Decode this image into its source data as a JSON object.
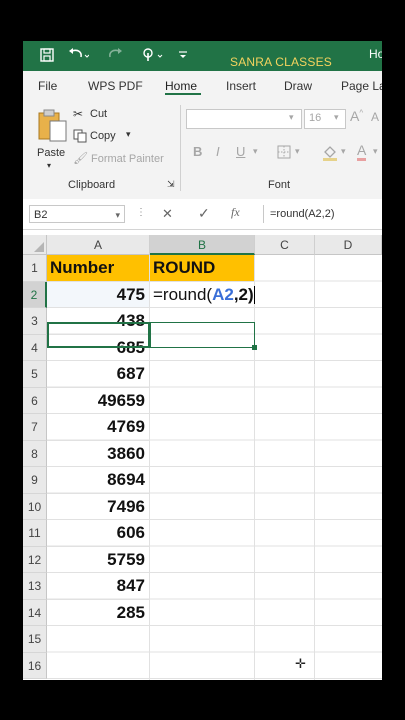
{
  "titlebar": {
    "app_title": "SANRA CLASSES",
    "account_partial": "Ho",
    "save_icon": "save-icon",
    "undo_icon": "undo-icon",
    "redo_icon": "redo-icon",
    "touch_icon": "touch-mode-icon",
    "customize_icon": "customize-qat-icon"
  },
  "ribbon_tabs": [
    "File",
    "WPS PDF",
    "Home",
    "Insert",
    "Draw",
    "Page La"
  ],
  "active_tab": "Home",
  "clipboard": {
    "paste": "Paste",
    "cut": "Cut",
    "copy": "Copy",
    "format_painter": "Format Painter",
    "group_label": "Clipboard"
  },
  "font": {
    "font_name": "",
    "font_size": "16",
    "bold": "B",
    "italic": "I",
    "underline": "U",
    "font_color": "A",
    "group_label": "Font"
  },
  "formula_bar": {
    "name_box": "B2",
    "cancel": "✕",
    "enter": "✓",
    "fx": "fx",
    "formula": "=round(A2,2)"
  },
  "columns": [
    "A",
    "B",
    "C",
    "D"
  ],
  "rows": [
    "1",
    "2",
    "3",
    "4",
    "5",
    "6",
    "7",
    "8",
    "9",
    "10",
    "11",
    "12",
    "13",
    "14",
    "15",
    "16"
  ],
  "headers": {
    "a1": "Number",
    "b1": "ROUND"
  },
  "values": [
    "475",
    "438",
    "685",
    "687",
    "49659",
    "4769",
    "3860",
    "8694",
    "7496",
    "606",
    "5759",
    "847",
    "285"
  ],
  "editing": {
    "prefix": "=round(",
    "ref": "A2",
    "suffix": ",2)"
  }
}
